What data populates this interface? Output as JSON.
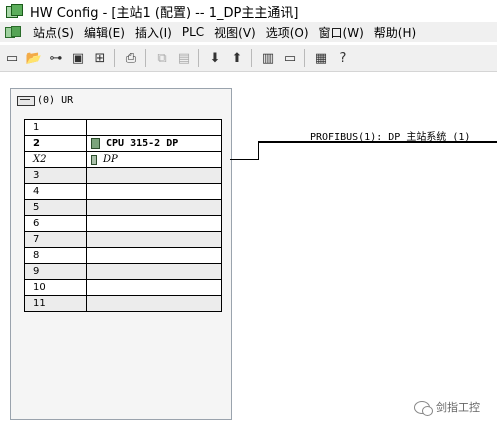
{
  "window": {
    "title": "HW Config - [主站1 (配置) -- 1_DP主主通讯]"
  },
  "menu": [
    "站点(S)",
    "编辑(E)",
    "插入(I)",
    "PLC",
    "视图(V)",
    "选项(O)",
    "窗口(W)",
    "帮助(H)"
  ],
  "toolbar": {
    "icons": [
      "new-icon",
      "open-icon",
      "network-icon",
      "save-icon",
      "compile-icon",
      "print-icon",
      "copy-icon",
      "paste-icon",
      "download-icon",
      "upload-icon",
      "properties-icon",
      "window-icon",
      "catalog-icon",
      "help-icon"
    ]
  },
  "rack": {
    "title": "(0) UR",
    "rows": [
      {
        "slot": "1",
        "module": ""
      },
      {
        "slot": "2",
        "module": "CPU 315-2 DP"
      },
      {
        "slot": "X2",
        "module": "DP"
      },
      {
        "slot": "3",
        "module": ""
      },
      {
        "slot": "4",
        "module": ""
      },
      {
        "slot": "5",
        "module": ""
      },
      {
        "slot": "6",
        "module": ""
      },
      {
        "slot": "7",
        "module": ""
      },
      {
        "slot": "8",
        "module": ""
      },
      {
        "slot": "9",
        "module": ""
      },
      {
        "slot": "10",
        "module": ""
      },
      {
        "slot": "11",
        "module": ""
      }
    ]
  },
  "bus": {
    "label": "PROFIBUS(1): DP 主站系统 (1)"
  },
  "watermark": {
    "text": "剑指工控"
  }
}
